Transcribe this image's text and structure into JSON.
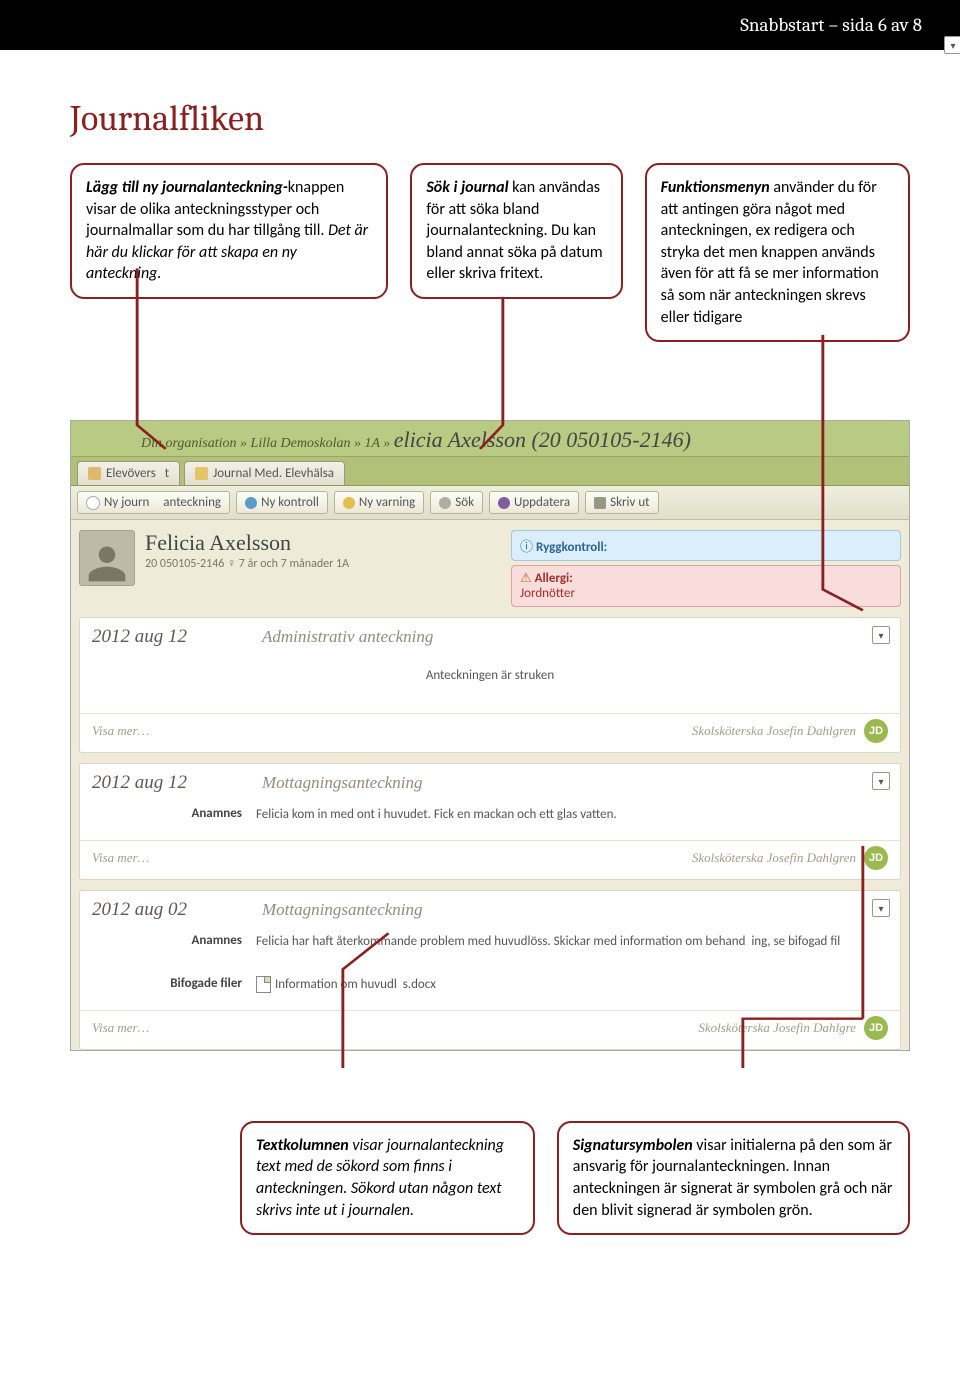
{
  "header": "Snabbstart – sida 6 av 8",
  "title": "Journalfliken",
  "callouts": {
    "c1a": "Lägg till ny journalanteckning-",
    "c1b": "knappen visar de olika anteckningsstyper och journalmallar som du har tillgång till.",
    "c1c": "Det är här du klickar för att skapa en ny anteckning.",
    "c2a": "Sök i journal",
    "c2b": " kan användas för att söka bland journalanteckning. Du kan bland annat söka på datum eller skriva fritext.",
    "c3a": "Funktionsmenyn",
    "c3b": " använder du för att antingen göra något med anteckningen, ex redigera och stryka det men knappen används även för att få se mer information så som när anteckningen skrevs eller tidigare",
    "b1a": "Textkolumnen",
    "b1b": " visar journalanteckning text med de sökord som finns i anteckningen. Sökord utan någon text skrivs inte ut i journalen.",
    "b2a": "Signatursymbolen",
    "b2b": "  visar initialerna på den som är ansvarig för journalanteckningen. Innan anteckningen är signerat är symbolen grå och när den blivit signerad är symbolen grön."
  },
  "screenshot": {
    "breadcrumb_prefix": "Din organisation » Lilla Demoskolan » 1A »",
    "breadcrumb_name": "elicia Axelsson (20 050105-2146)",
    "tabs": {
      "t1": "Elevövers",
      "t1b": "t",
      "t2": "Journal Med. Elevhälsa"
    },
    "toolbar": {
      "b1a": "Ny journ",
      "b1b": "anteckning",
      "b2": "Ny kontroll",
      "b3": "Ny varning",
      "b4": "Sök",
      "b5": "Uppdatera",
      "b6": "Skriv ut"
    },
    "profile": {
      "name": "Felicia Axelsson",
      "sub": "20 050105-2146 ♀ 7 år och 7 månader 1A"
    },
    "alerts": {
      "rygg_title": "Ryggkontroll:",
      "allergi_title": "Allergi:",
      "allergi_body": "Jordnötter"
    },
    "entries": [
      {
        "date": "2012 aug 12",
        "type": "Administrativ anteckning",
        "center": "Anteckningen är struken",
        "footer_left": "Visa mer…",
        "footer_right": "Skolsköterska Josefin Dahlgren",
        "sig": "JD",
        "sig_class": "sig-green"
      },
      {
        "date": "2012 aug 12",
        "type": "Mottagningsanteckning",
        "rows": [
          {
            "label": "Anamnes",
            "value": "Felicia kom in med ont i huvudet. Fick en mackan och ett glas vatten."
          }
        ],
        "footer_left": "Visa mer…",
        "footer_right": "Skolsköterska Josefin Dahlgren",
        "sig": "JD",
        "sig_class": "sig-green"
      },
      {
        "date": "2012 aug 02",
        "type": "Mottagningsanteckning",
        "rows": [
          {
            "label": "Anamnes",
            "value_a": "Felicia har haft återkommande problem med huvudlöss. Skickar med information om behand",
            "value_b": "ing, se bifogad fil"
          },
          {
            "label": "Bifogade filer",
            "file": "Information om huvudl",
            "file_b": "s.docx"
          }
        ],
        "footer_left": "Visa mer…",
        "footer_right": "Skolsköterska Josefin Dahlgre",
        "sig": "JD",
        "sig_class": "sig-green"
      }
    ]
  }
}
